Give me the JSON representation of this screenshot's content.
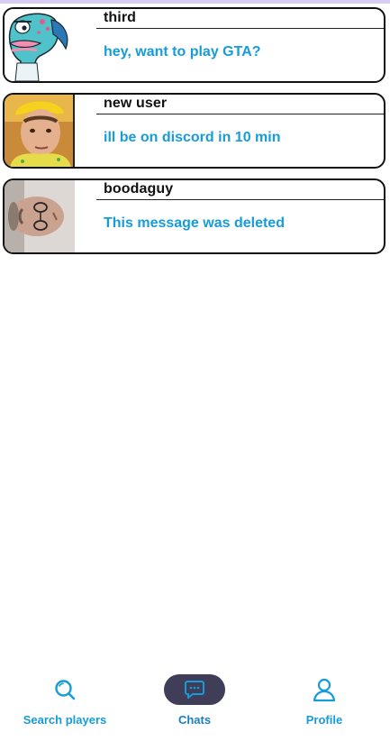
{
  "chats": [
    {
      "username": "third",
      "message": "hey, want to play GTA?",
      "avatar_icon": "cartoon-fish-avatar"
    },
    {
      "username": "new user",
      "message": "ill be on discord in 10 min",
      "avatar_icon": "person-photo-avatar"
    },
    {
      "username": "boodaguy",
      "message": "This message was deleted",
      "avatar_icon": "person-photo-avatar"
    }
  ],
  "nav": {
    "items": [
      {
        "label": "Search players",
        "icon": "search-icon"
      },
      {
        "label": "Chats",
        "icon": "chat-bubble-icon"
      },
      {
        "label": "Profile",
        "icon": "user-icon"
      }
    ],
    "active": "Chats"
  },
  "colors": {
    "accent": "#169cd8",
    "active_pill": "#3f3d57",
    "card_border": "#111111",
    "top_strip": "#d9ccf2"
  }
}
